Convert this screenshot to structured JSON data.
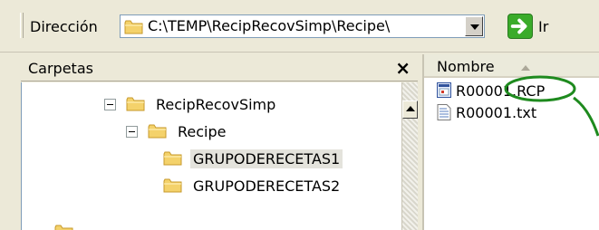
{
  "address_bar": {
    "label": "Dirección",
    "path": "C:\\TEMP\\RecipRecovSimp\\Recipe\\",
    "go_label": "Ir"
  },
  "folders_pane": {
    "title": "Carpetas",
    "close_glyph": "×",
    "tree": [
      {
        "label": "RecipRecovSimp",
        "expanded": true,
        "selected": false
      },
      {
        "label": "Recipe",
        "expanded": true,
        "selected": false
      },
      {
        "label": "GRUPODERECETAS1",
        "selected": true
      },
      {
        "label": "GRUPODERECETAS2",
        "selected": false
      }
    ]
  },
  "files_pane": {
    "column_header": "Nombre",
    "files": [
      {
        "name": "R00001.RCP",
        "icon": "rcp-file-icon"
      },
      {
        "name": "R00001.txt",
        "icon": "text-file-icon"
      }
    ]
  },
  "colors": {
    "selection": "#e4e3dc",
    "folder": "#f4d26b",
    "annotation": "#1e8a1e",
    "go_button": "#3aab2a"
  }
}
